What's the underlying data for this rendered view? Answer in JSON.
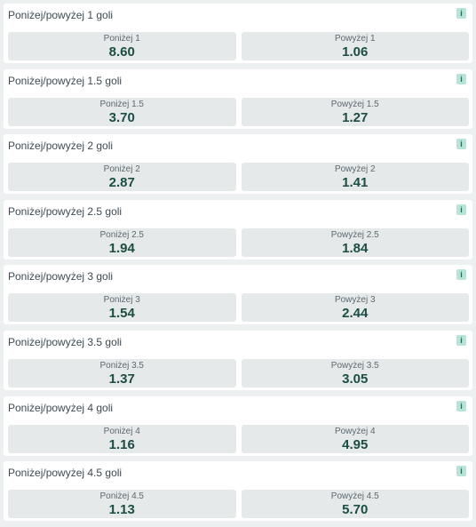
{
  "info_glyph": "i",
  "colors": {
    "background": "#edf0f0",
    "card": "#ffffff",
    "odds_button": "#e6e9e9",
    "odds_value": "#1b4d44",
    "info_badge": "#b7e3d8"
  },
  "markets": [
    {
      "title": "Poniżej/powyżej 1 goli",
      "under_label": "Poniżej 1",
      "under_odds": "8.60",
      "over_label": "Powyżej 1",
      "over_odds": "1.06"
    },
    {
      "title": "Poniżej/powyżej 1.5 goli",
      "under_label": "Poniżej 1.5",
      "under_odds": "3.70",
      "over_label": "Powyżej 1.5",
      "over_odds": "1.27"
    },
    {
      "title": "Poniżej/powyżej 2 goli",
      "under_label": "Poniżej 2",
      "under_odds": "2.87",
      "over_label": "Powyżej 2",
      "over_odds": "1.41"
    },
    {
      "title": "Poniżej/powyżej 2.5 goli",
      "under_label": "Poniżej 2.5",
      "under_odds": "1.94",
      "over_label": "Powyżej 2.5",
      "over_odds": "1.84"
    },
    {
      "title": "Poniżej/powyżej 3 goli",
      "under_label": "Poniżej 3",
      "under_odds": "1.54",
      "over_label": "Powyżej 3",
      "over_odds": "2.44"
    },
    {
      "title": "Poniżej/powyżej 3.5 goli",
      "under_label": "Poniżej 3.5",
      "under_odds": "1.37",
      "over_label": "Powyżej 3.5",
      "over_odds": "3.05"
    },
    {
      "title": "Poniżej/powyżej 4 goli",
      "under_label": "Poniżej 4",
      "under_odds": "1.16",
      "over_label": "Powyżej 4",
      "over_odds": "4.95"
    },
    {
      "title": "Poniżej/powyżej 4.5 goli",
      "under_label": "Poniżej 4.5",
      "under_odds": "1.13",
      "over_label": "Powyżej 4.5",
      "over_odds": "5.70"
    }
  ]
}
